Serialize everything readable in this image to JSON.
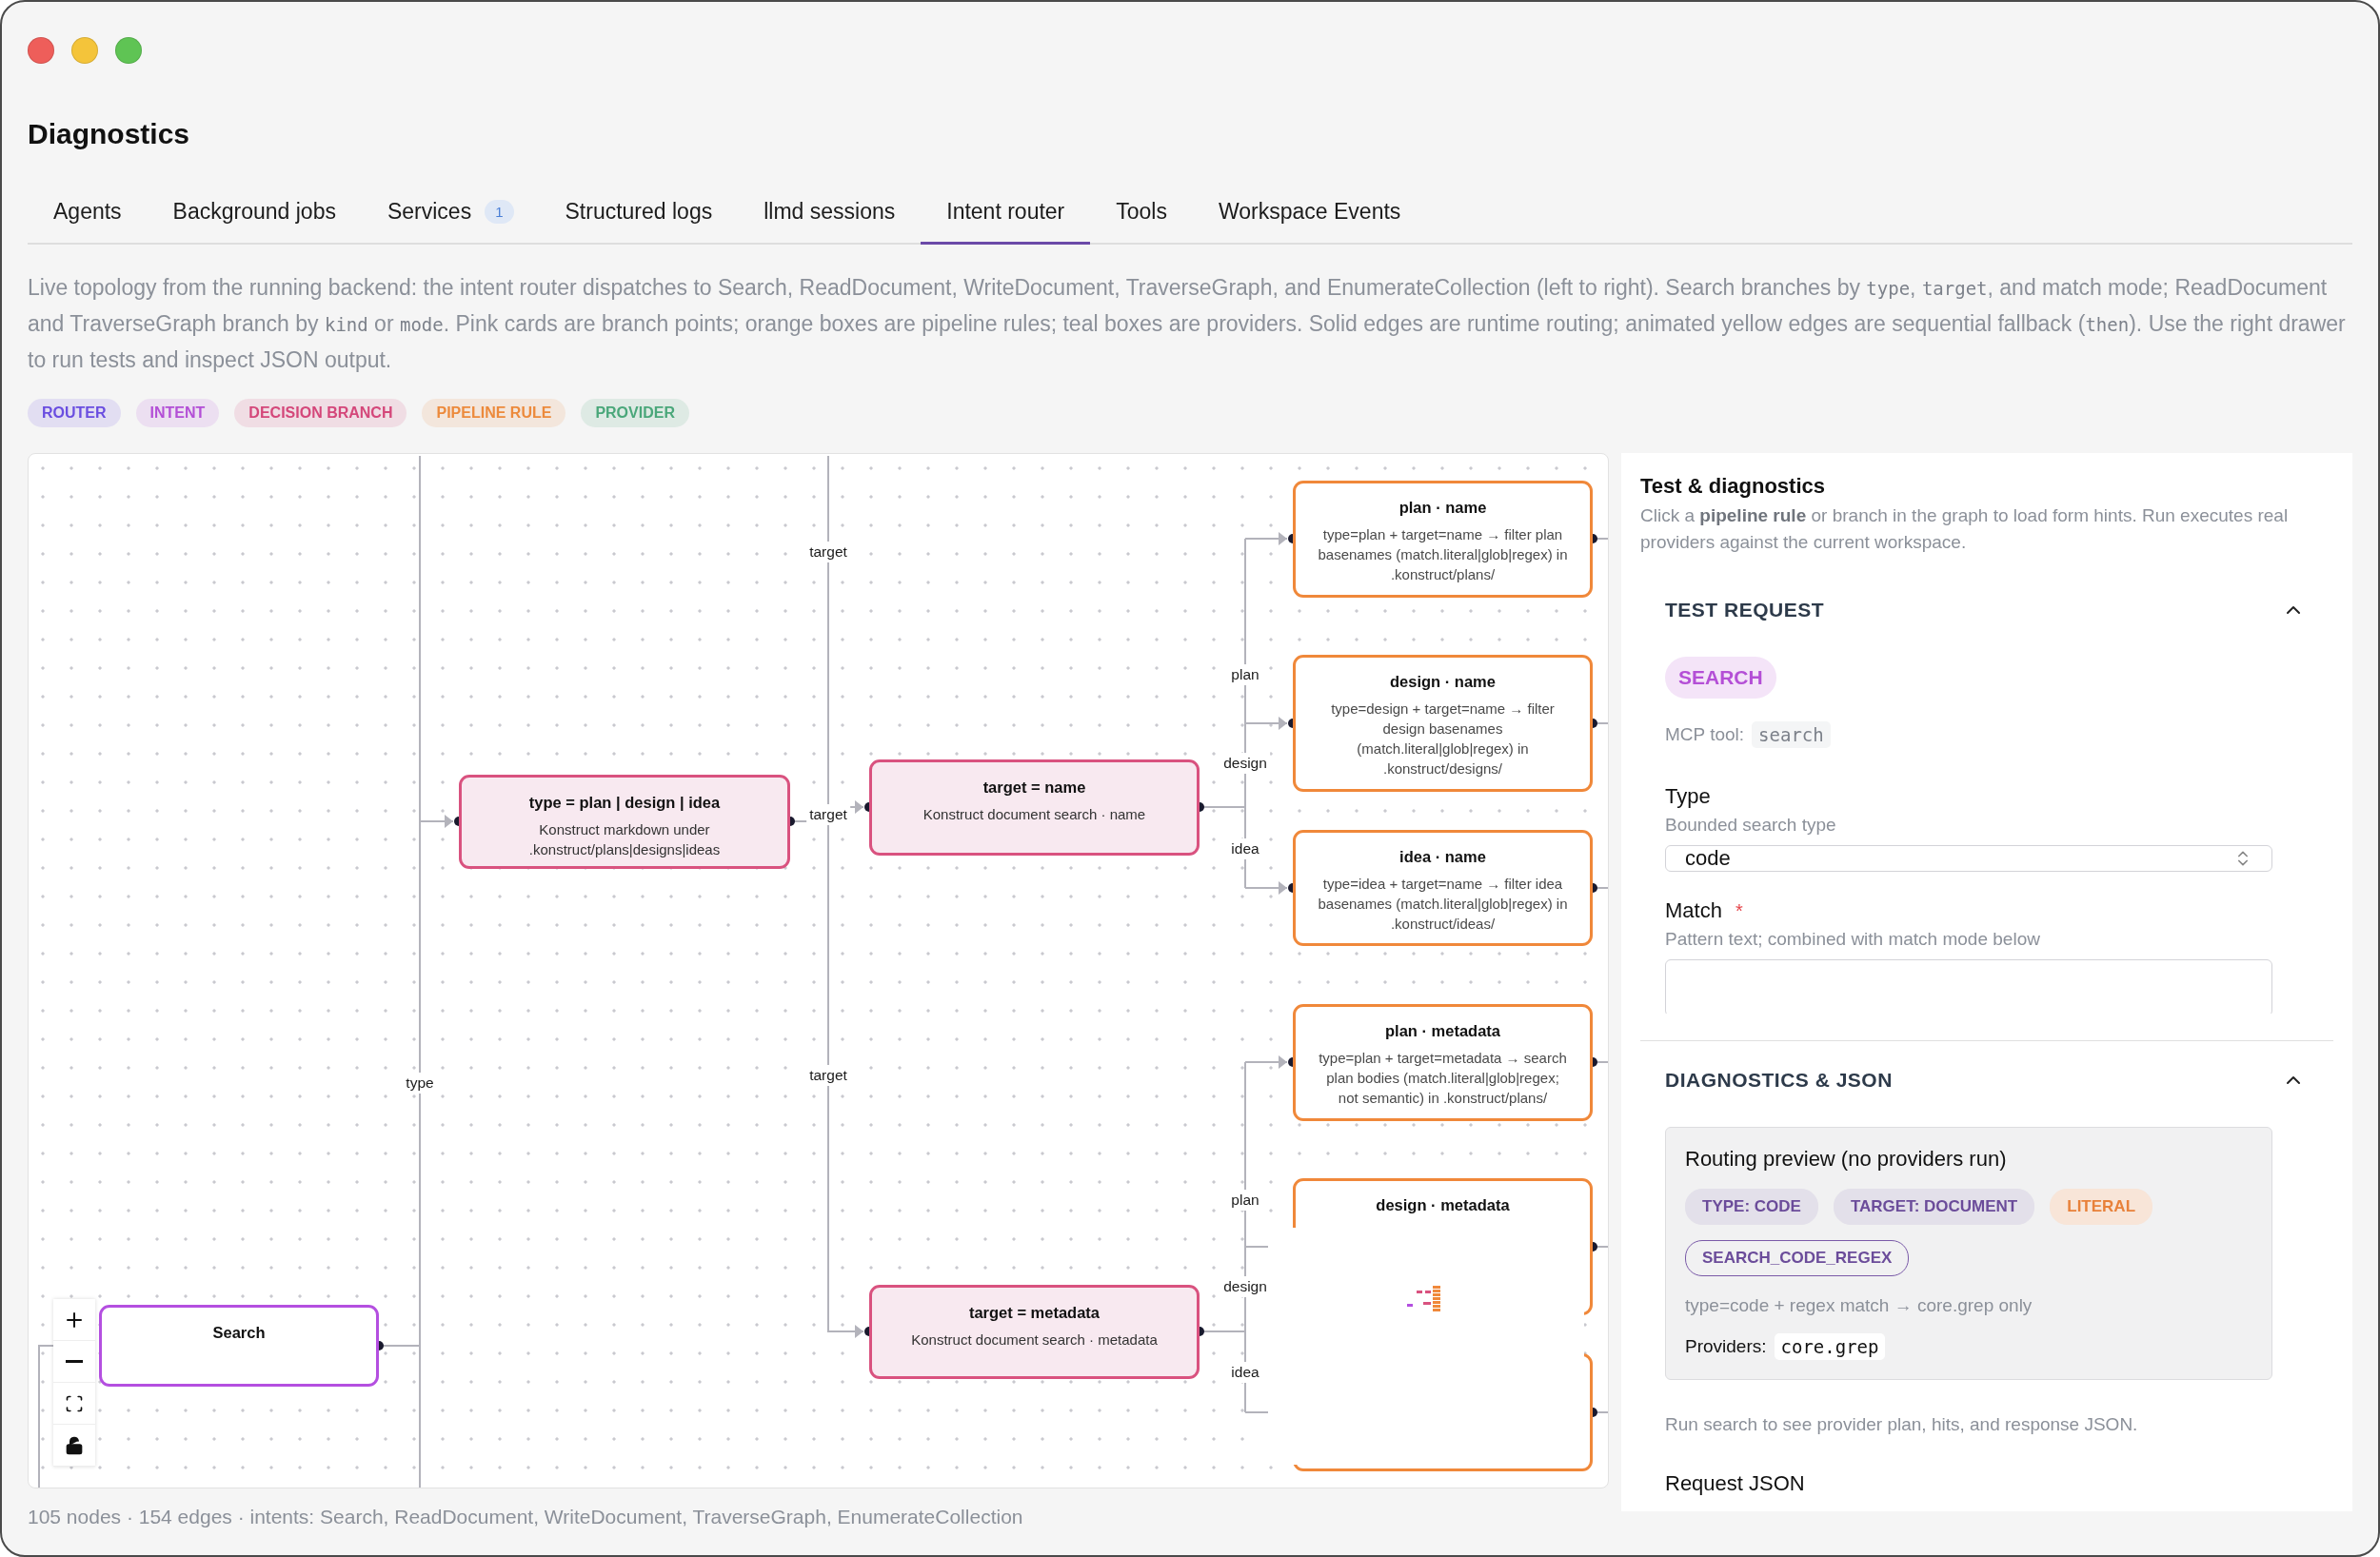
{
  "window": {
    "title": "Diagnostics"
  },
  "tabs": [
    {
      "label": "Agents",
      "selected": false
    },
    {
      "label": "Background jobs",
      "selected": false
    },
    {
      "label": "Services",
      "badge": "1",
      "selected": false
    },
    {
      "label": "Structured logs",
      "selected": false
    },
    {
      "label": "llmd sessions",
      "selected": false
    },
    {
      "label": "Intent router",
      "selected": true
    },
    {
      "label": "Tools",
      "selected": false
    },
    {
      "label": "Workspace Events",
      "selected": false
    }
  ],
  "description": [
    {
      "kind": "text",
      "text": "Live topology from the running backend: the intent router dispatches to Search, ReadDocument, WriteDocument, TraverseGraph, and EnumerateCollection (left to right). Search branches by "
    },
    {
      "kind": "code",
      "text": "type"
    },
    {
      "kind": "text",
      "text": ", "
    },
    {
      "kind": "code",
      "text": "target"
    },
    {
      "kind": "text",
      "text": ", and match mode; ReadDocument and TraverseGraph branch by "
    },
    {
      "kind": "code",
      "text": "kind"
    },
    {
      "kind": "text",
      "text": " or "
    },
    {
      "kind": "code",
      "text": "mode"
    },
    {
      "kind": "text",
      "text": ". Pink cards are branch points; orange boxes are pipeline rules; teal boxes are providers. Solid edges are runtime routing; animated yellow edges are sequential fallback ("
    },
    {
      "kind": "code",
      "text": "then"
    },
    {
      "kind": "text",
      "text": "). Use the right drawer to run tests and inspect JSON output."
    }
  ],
  "legend": [
    {
      "label": "ROUTER",
      "color": "#6a4ee0"
    },
    {
      "label": "INTENT",
      "color": "#b34fd6"
    },
    {
      "label": "DECISION BRANCH",
      "color": "#d4477a"
    },
    {
      "label": "PIPELINE RULE",
      "color": "#ec8a3c"
    },
    {
      "label": "PROVIDER",
      "color": "#4aa77a"
    }
  ],
  "graph": {
    "nodes": [
      {
        "kind": "intent",
        "title": "Search"
      },
      {
        "kind": "branch",
        "title": "type = plan | design | idea",
        "subtitle": "Konstruct markdown under .konstruct/plans|designs|ideas"
      },
      {
        "kind": "branch",
        "title": "target = name",
        "subtitle": "Konstruct document search · name"
      },
      {
        "kind": "branch",
        "title": "target = metadata",
        "subtitle": "Konstruct document search · metadata"
      },
      {
        "kind": "rule",
        "title": "plan · name",
        "subtitle": "type=plan + target=name → filter plan basenames (match.literal|glob|regex) in .konstruct/plans/"
      },
      {
        "kind": "rule",
        "title": "design · name",
        "subtitle": "type=design + target=name → filter design basenames (match.literal|glob|regex) in .konstruct/designs/"
      },
      {
        "kind": "rule",
        "title": "idea · name",
        "subtitle": "type=idea + target=name → filter idea basenames (match.literal|glob|regex) in .konstruct/ideas/"
      },
      {
        "kind": "rule",
        "title": "plan · metadata",
        "subtitle": "type=plan + target=metadata → search plan bodies (match.literal|glob|regex; not semantic) in .konstruct/plans/"
      },
      {
        "kind": "rule",
        "title": "design · metadata"
      },
      {
        "kind": "rule"
      }
    ],
    "edge_labels": [
      "target",
      "plan",
      "design",
      "target",
      "idea",
      "target",
      "type",
      "plan",
      "design",
      "idea"
    ],
    "status": "105 nodes · 154 edges · intents: Search, ReadDocument, WriteDocument, TraverseGraph, EnumerateCollection"
  },
  "panel": {
    "title": "Test & diagnostics",
    "intro": "Click a **pipeline rule** or branch in the graph to load form hints. Run executes real providers against the current workspace.",
    "test_request": {
      "title": "TEST REQUEST",
      "expanded": true,
      "intent_chip": "SEARCH",
      "mcp_label": "MCP tool:",
      "mcp_tool": "search",
      "type_field": {
        "label": "Type",
        "hint": "Bounded search type",
        "value": "code"
      },
      "match_field": {
        "label": "Match",
        "required_mark": "*",
        "hint": "Pattern text; combined with match mode below"
      }
    },
    "diagnostics": {
      "title": "DIAGNOSTICS & JSON",
      "expanded": true,
      "preview": {
        "title": "Routing preview (no providers run)",
        "chips": [
          {
            "kind": "tag",
            "label": "TYPE: CODE"
          },
          {
            "kind": "tag",
            "label": "TARGET: DOCUMENT"
          },
          {
            "kind": "mode",
            "label": "LITERAL"
          },
          {
            "kind": "rule",
            "label": "SEARCH_CODE_REGEX"
          }
        ],
        "note": "type=code + regex match → core.grep only",
        "providers_label": "Providers:",
        "providers": [
          "core.grep"
        ]
      },
      "hint": "Run search to see provider plan, hits, and response JSON.",
      "request_json_label": "Request JSON"
    }
  }
}
